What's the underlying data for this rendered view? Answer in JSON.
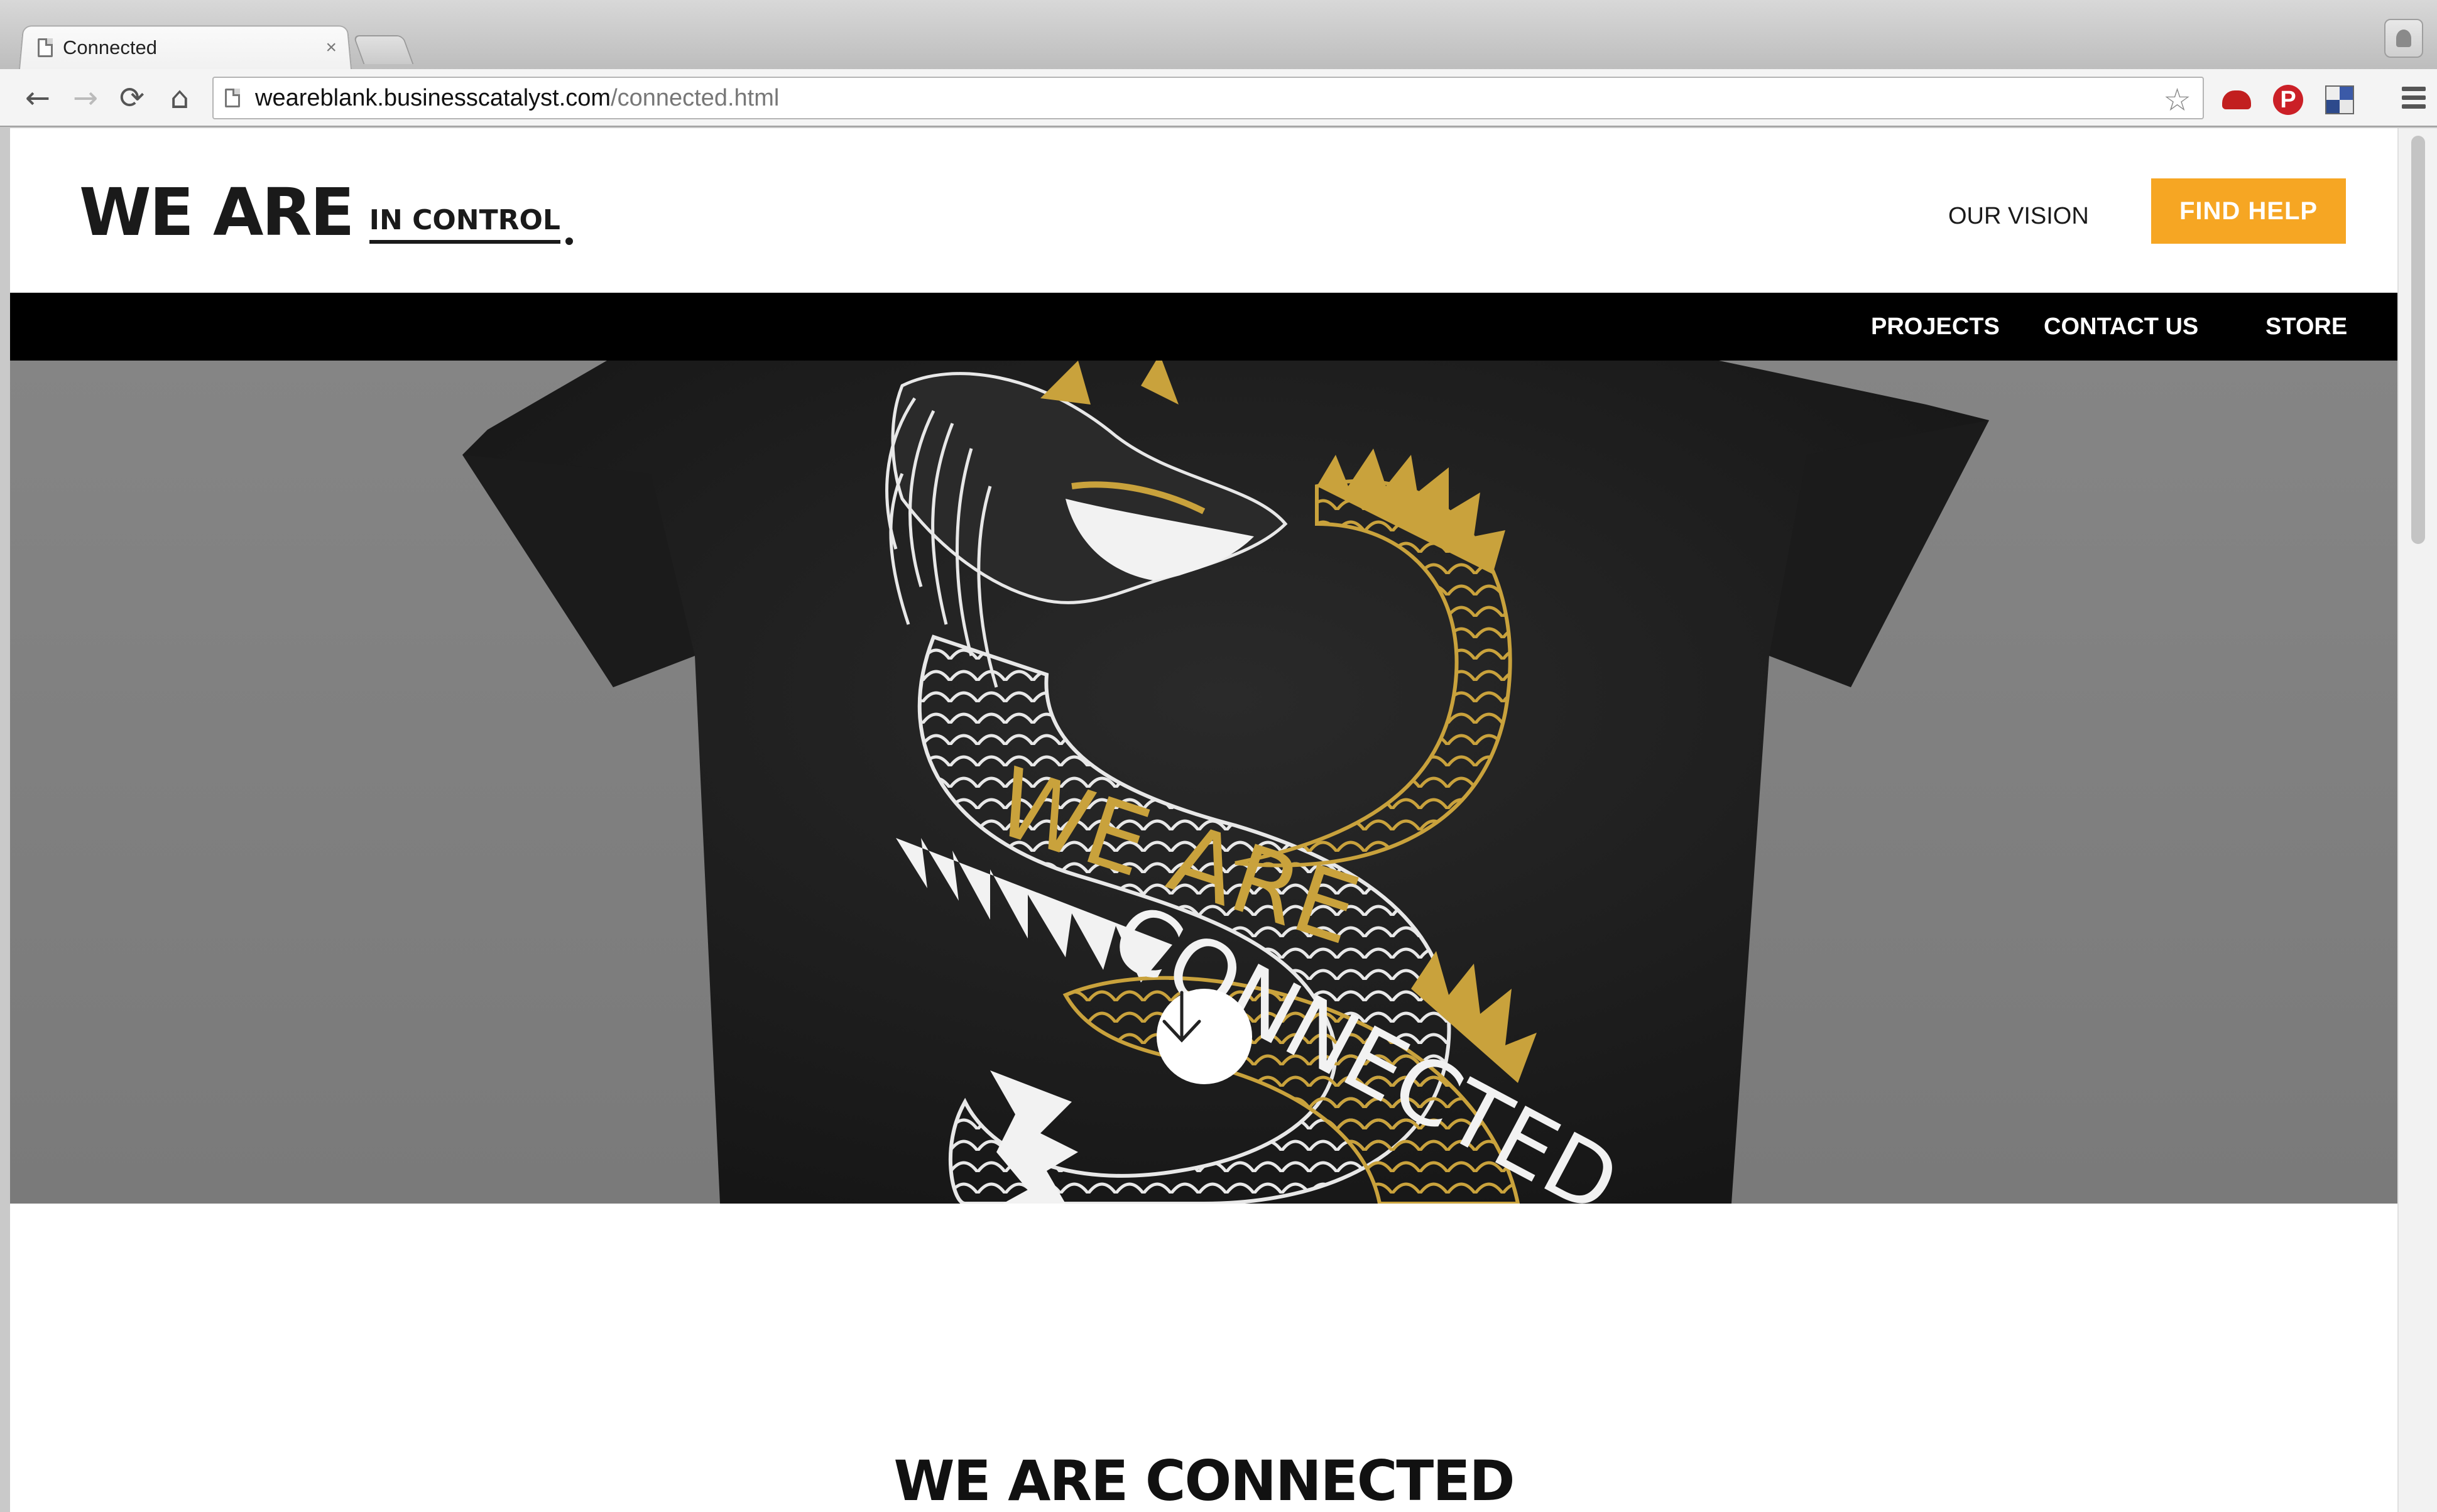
{
  "browser": {
    "tab_title": "Connected",
    "tab_close": "×",
    "url_host": "weareblank.businesscatalyst.com",
    "url_path": "/connected.html"
  },
  "header": {
    "logo_main": "WE ARE",
    "logo_sub": "IN CONTROL",
    "our_vision": "OUR VISION",
    "find_help": "FIND HELP"
  },
  "nav": {
    "projects": "PROJECTS",
    "contact_us": "CONTACT US",
    "store": "STORE"
  },
  "hero": {
    "shirt_text_1": "WE ARE",
    "shirt_text_2": "CONNECTED"
  },
  "intro": {
    "title": "WE ARE CONNECTED"
  },
  "colors": {
    "accent": "#f6a623",
    "gold": "#c9a23c",
    "nav_bg": "#000000",
    "hero_bg": "#808080"
  },
  "icons": [
    "page-icon",
    "back-arrow-icon",
    "forward-arrow-icon",
    "reload-icon",
    "home-icon",
    "star-icon",
    "menu-icon",
    "arrow-down-icon"
  ]
}
